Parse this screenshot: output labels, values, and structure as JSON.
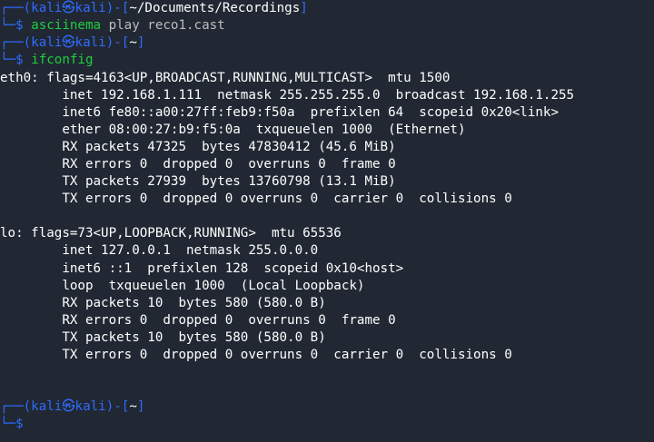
{
  "prompt": {
    "top_prefix": "┌──(",
    "user": "kali",
    "separator": "㉿",
    "host": "kali",
    "after_host": ")-[",
    "close_bracket": "]",
    "bottom_prefix": "└─",
    "symbol": "$"
  },
  "session1": {
    "dir": "~/Documents/Recordings",
    "command": "asciinema",
    "args": " play reco1.cast"
  },
  "session2": {
    "dir": "~",
    "command": "ifconfig"
  },
  "session3": {
    "dir": "~"
  },
  "output": [
    "eth0: flags=4163<UP,BROADCAST,RUNNING,MULTICAST>  mtu 1500",
    "        inet 192.168.1.111  netmask 255.255.255.0  broadcast 192.168.1.255",
    "        inet6 fe80::a00:27ff:feb9:f50a  prefixlen 64  scopeid 0x20<link>",
    "        ether 08:00:27:b9:f5:0a  txqueuelen 1000  (Ethernet)",
    "        RX packets 47325  bytes 47830412 (45.6 MiB)",
    "        RX errors 0  dropped 0  overruns 0  frame 0",
    "        TX packets 27939  bytes 13760798 (13.1 MiB)",
    "        TX errors 0  dropped 0 overruns 0  carrier 0  collisions 0",
    "",
    "lo: flags=73<UP,LOOPBACK,RUNNING>  mtu 65536",
    "        inet 127.0.0.1  netmask 255.0.0.0",
    "        inet6 ::1  prefixlen 128  scopeid 0x10<host>",
    "        loop  txqueuelen 1000  (Local Loopback)",
    "        RX packets 10  bytes 580 (580.0 B)",
    "        RX errors 0  dropped 0  overruns 0  frame 0",
    "        TX packets 10  bytes 580 (580.0 B)",
    "        TX errors 0  dropped 0 overruns 0  carrier 0  collisions 0"
  ],
  "colors": {
    "background": "#212833",
    "prompt_blue": "#2f6bff",
    "command_green": "#1fcf3f",
    "text": "#ffffff",
    "args_dim": "#bcbcbc"
  },
  "icons": {
    "cursor": "text-cursor-icon"
  }
}
